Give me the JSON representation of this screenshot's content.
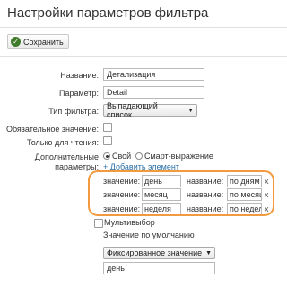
{
  "header": {
    "title": "Настройки параметров фильтра"
  },
  "toolbar": {
    "save_label": "Сохранить",
    "save_icon": "check-icon"
  },
  "form": {
    "name": {
      "label": "Название:",
      "value": "Детализация"
    },
    "param": {
      "label": "Параметр:",
      "value": "Detail"
    },
    "filter_type": {
      "label": "Тип фильтра:",
      "value": "Выпадающий список"
    },
    "required": {
      "label": "Обязательное значение:",
      "checked": false
    },
    "readonly": {
      "label": "Только для чтения:",
      "checked": false
    },
    "additional": {
      "label_line1": "Дополнительные",
      "label_line2": "параметры:",
      "mode_own": "Свой",
      "mode_expr": "Смарт-выражение",
      "selected_mode": "own",
      "add_link": "+ Добавить элемент",
      "value_label": "значение:",
      "name_label": "название:",
      "delete_label": "x",
      "items": [
        {
          "value": "день",
          "name": "по дням"
        },
        {
          "value": "месяц",
          "name": "по месяцам"
        },
        {
          "value": "неделя",
          "name": "по неделям"
        }
      ]
    },
    "multiselect": {
      "label": "Мультивыбор",
      "checked": false
    },
    "default": {
      "label": "Значение по умолчанию",
      "type": "Фиксированное значение",
      "value": "день"
    }
  },
  "colors": {
    "highlight": "#f19a3e",
    "link": "#2a6fa8",
    "save_icon": "#3f7b2b"
  }
}
